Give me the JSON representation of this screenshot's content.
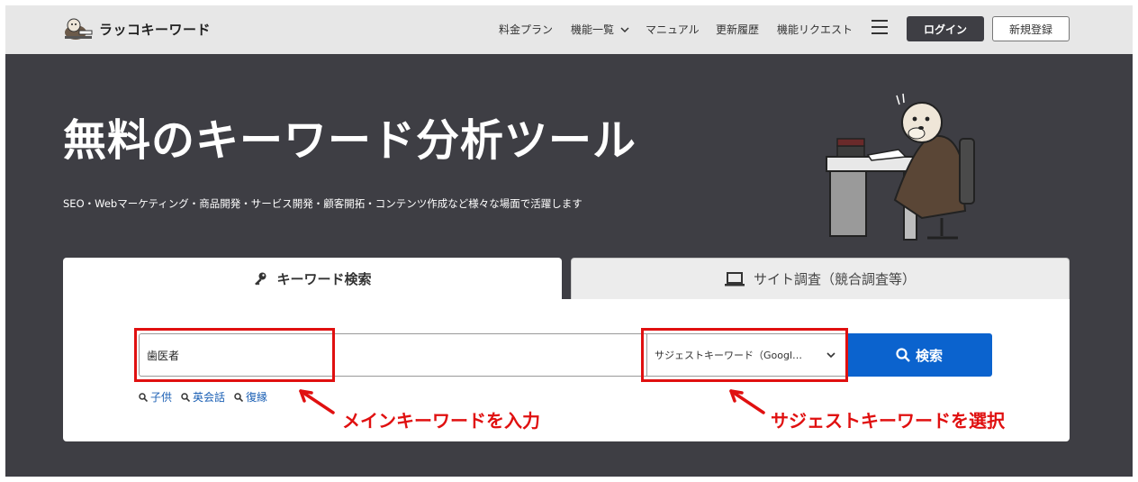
{
  "header": {
    "logo_text": "ラッコキーワード",
    "nav": [
      "料金プラン",
      "機能一覧",
      "マニュアル",
      "更新履歴",
      "機能リクエスト"
    ],
    "login_label": "ログイン",
    "signup_label": "新規登録"
  },
  "hero": {
    "title": "無料のキーワード分析ツール",
    "subtitle": "SEO・Webマーケティング・商品開発・サービス開発・顧客開拓・コンテンツ作成など様々な場面で活躍します"
  },
  "tabs": {
    "keyword_label": "キーワード検索",
    "site_label": "サイト調査（競合調査等）"
  },
  "search": {
    "input_value": "歯医者",
    "select_value": "サジェストキーワード（Googl…",
    "button_label": "検索",
    "examples": [
      "子供",
      "英会話",
      "復縁"
    ]
  },
  "annotations": {
    "main_keyword": "メインキーワードを入力",
    "suggest": "サジェストキーワードを選択"
  },
  "colors": {
    "hero_background": "#3e3e44",
    "header_background": "#e7e7e7",
    "accent_blue": "#0b63ce",
    "annotation_red": "#e01010"
  }
}
